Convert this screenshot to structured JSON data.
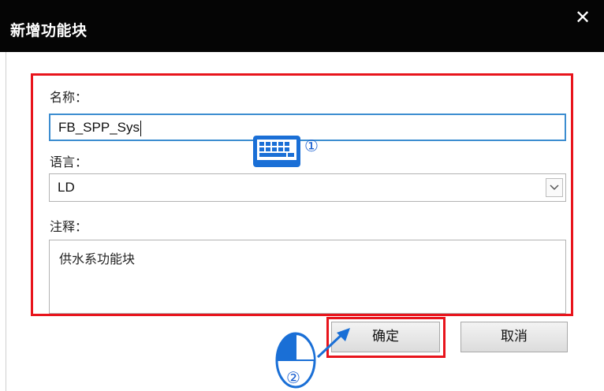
{
  "dialog": {
    "title": "新增功能块",
    "close_glyph": "✕"
  },
  "form": {
    "name_label": "名称：",
    "name_value": "FB_SPP_Sys",
    "language_label": "语言：",
    "language_value": "LD",
    "comment_label": "注释：",
    "comment_value": "供水系功能块"
  },
  "buttons": {
    "ok_label": "确定",
    "cancel_label": "取消"
  },
  "annotations": {
    "step1": "①",
    "step2": "②",
    "step1_icon": "keyboard-icon",
    "step2_icon": "mouse-left-click-icon",
    "highlight_color": "#e8141c",
    "accent_color": "#1a6fd6"
  }
}
